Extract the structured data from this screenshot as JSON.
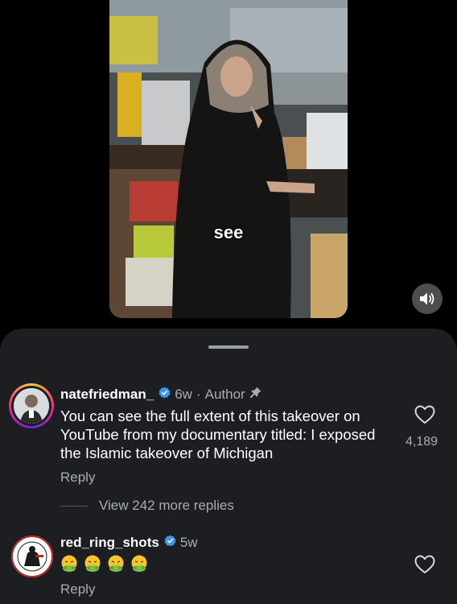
{
  "video": {
    "caption": "see"
  },
  "comments": [
    {
      "username": "natefriedman_",
      "age": "6w",
      "separator": "·",
      "role": "Author",
      "text": "You can see the full extent of this takeover on YouTube from my documentary titled: I exposed the Islamic takeover of Michigan",
      "likes": "4,189",
      "reply_label": "Reply",
      "view_replies": "View 242 more replies"
    },
    {
      "username": "red_ring_shots",
      "age": "5w",
      "text_emoji": [
        "nauseated-face",
        "nauseated-face",
        "nauseated-face",
        "nauseated-face"
      ],
      "reply_label": "Reply"
    }
  ],
  "colors": {
    "sheet_bg": "#1c1e21",
    "verified_blue": "#3897f0",
    "muted_text": "#a8adb3"
  }
}
